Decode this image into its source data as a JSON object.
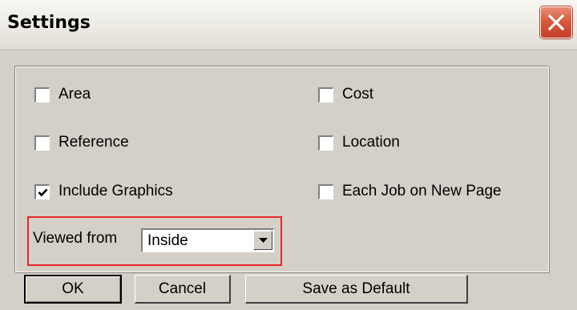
{
  "window": {
    "title": "Settings",
    "close_icon": "close-x-icon"
  },
  "options": {
    "area": {
      "label": "Area",
      "checked": false
    },
    "cost": {
      "label": "Cost",
      "checked": false
    },
    "reference": {
      "label": "Reference",
      "checked": false
    },
    "location": {
      "label": "Location",
      "checked": false
    },
    "include_graphics": {
      "label": "Include Graphics",
      "checked": true
    },
    "each_job_new_page": {
      "label": "Each Job on New Page",
      "checked": false
    }
  },
  "viewed_from": {
    "label": "Viewed from",
    "value": "Inside"
  },
  "buttons": {
    "ok": "OK",
    "cancel": "Cancel",
    "save_default": "Save as Default"
  },
  "colors": {
    "highlight": "#e8262a",
    "close_button": "#d85a3e"
  }
}
